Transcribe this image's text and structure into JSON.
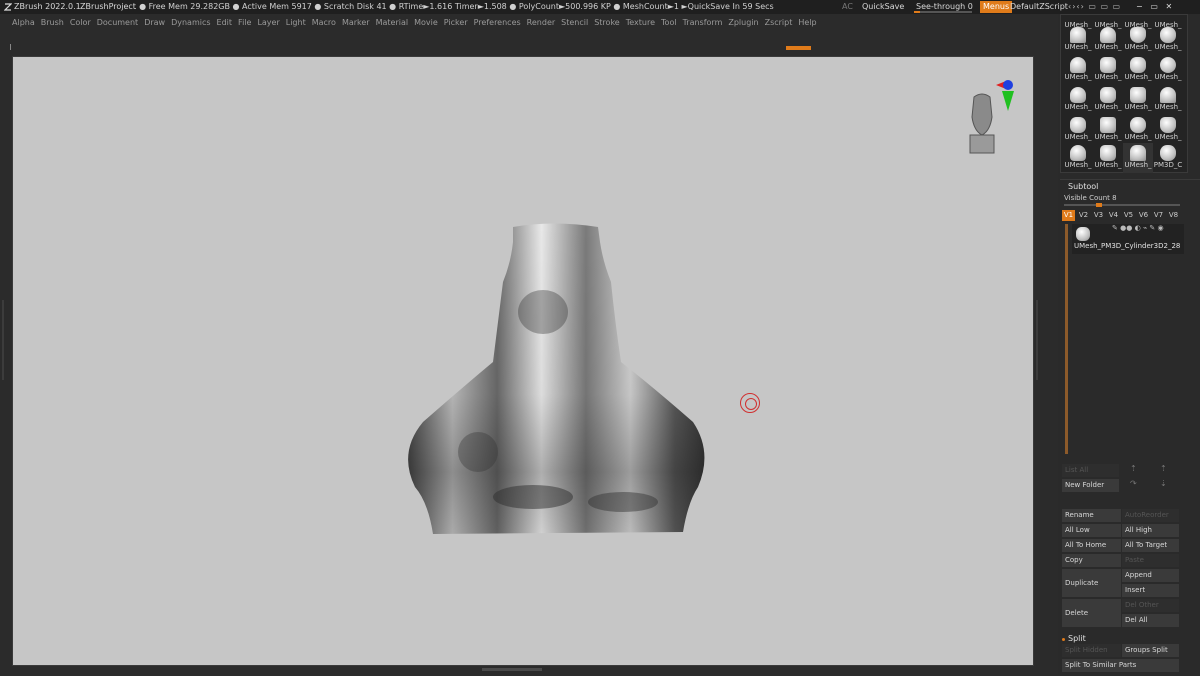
{
  "titlebar": {
    "app": "ZBrush 2022.0.1",
    "project": "ZBrushProject",
    "stats": ". ● Free Mem 29.282GB ● Active Mem 5917 ● Scratch Disk 41 ● RTime►1.616 Timer►1.508 ● PolyCount►500.996 KP ● MeshCount►1 ►QuickSave In 59 Secs",
    "ac": "AC",
    "quicksave": "QuickSave",
    "see_through": "See-through  0",
    "menus": "Menus",
    "default_zscript": "DefaultZScript",
    "accent": "#e07b1a"
  },
  "menubar": [
    "Alpha",
    "Brush",
    "Color",
    "Document",
    "Draw",
    "Dynamics",
    "Edit",
    "File",
    "Layer",
    "Light",
    "Macro",
    "Marker",
    "Material",
    "Movie",
    "Picker",
    "Preferences",
    "Render",
    "Stencil",
    "Stroke",
    "Texture",
    "Tool",
    "Transform",
    "Zplugin",
    "Zscript",
    "Help"
  ],
  "tool_palette": {
    "thumb_label": "UMesh_",
    "last_label": "PM3D_C"
  },
  "subtool": {
    "title": "Subtool",
    "visible_count": "Visible Count 8",
    "versions": [
      "V1",
      "V2",
      "V3",
      "V4",
      "V5",
      "V6",
      "V7",
      "V8"
    ],
    "item_name": "UMesh_PM3D_Cylinder3D2_28"
  },
  "buttons": {
    "list_all": "List All",
    "new_folder": "New Folder",
    "rename": "Rename",
    "auto_reorder": "AutoReorder",
    "all_low": "All Low",
    "all_high": "All High",
    "all_to_home": "All To Home",
    "all_to_target": "All To Target",
    "copy": "Copy",
    "paste": "Paste",
    "duplicate": "Duplicate",
    "append": "Append",
    "insert": "Insert",
    "delete": "Delete",
    "del_other": "Del Other",
    "del_all": "Del All",
    "split": "Split",
    "split_hidden": "Split Hidden",
    "groups_split": "Groups Split",
    "split_to_similar": "Split To Similar Parts"
  }
}
